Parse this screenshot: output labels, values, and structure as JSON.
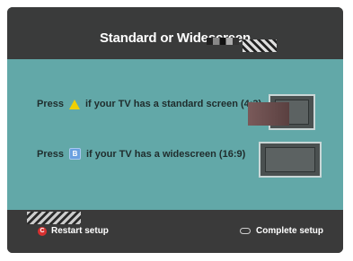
{
  "header": {
    "title": "Standard or Widescreen"
  },
  "options": [
    {
      "press_label": "Press",
      "button_key": "A",
      "text": "if your TV has a standard screen (4:3)"
    },
    {
      "press_label": "Press",
      "button_key": "B",
      "text": "if your TV has a widescreen (16:9)"
    }
  ],
  "footer": {
    "left_key": "C",
    "left_label": "Restart setup",
    "right_label": "Complete setup"
  },
  "colors": {
    "header_bg": "#3a3b3b",
    "panel_bg": "#62a8a8",
    "button_a": "#f0d000",
    "button_b": "#6aa0e0",
    "button_c": "#d83030"
  }
}
